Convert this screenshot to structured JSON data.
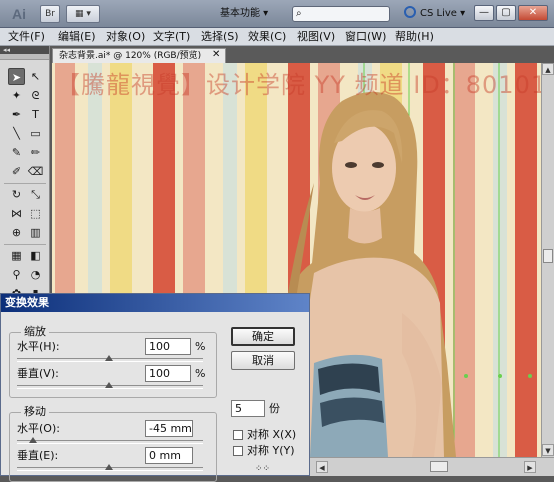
{
  "app": {
    "logo": "Ai",
    "workspace": "基本功能 ▾",
    "search_placeholder": "",
    "cs_live": "CS Live ▾",
    "window_buttons": {
      "minimize": "—",
      "restore": "▢",
      "close": "✕"
    }
  },
  "menu": [
    "文件(F)",
    "编辑(E)",
    "对象(O)",
    "文字(T)",
    "选择(S)",
    "效果(C)",
    "视图(V)",
    "窗口(W)",
    "帮助(H)"
  ],
  "document": {
    "tab": "杂志背景.ai* @ 120% (RGB/预览)",
    "tab_close": "✕",
    "watermark": "【騰龍視覺】设计学院 YY 频道 ID：80101"
  },
  "colors": {
    "stripe_red": "#d95c45",
    "stripe_salmon": "#e7a78f",
    "stripe_yellow": "#f0db85",
    "stripe_cream": "#f3e7c4",
    "stripe_mint": "#d8e2d6"
  },
  "dialog": {
    "title": "变换效果",
    "scale": {
      "group_label": "缩放",
      "horizontal_label": "水平(H):",
      "horizontal_value": "100",
      "horizontal_unit": "%",
      "vertical_label": "垂直(V):",
      "vertical_value": "100",
      "vertical_unit": "%"
    },
    "move": {
      "group_label": "移动",
      "horizontal_label": "水平(O):",
      "horizontal_value": "-45 mm",
      "vertical_label": "垂直(E):",
      "vertical_value": "0 mm"
    },
    "ok_label": "确定",
    "cancel_label": "取消",
    "copies_value": "5",
    "copies_label": "份",
    "reflect_x_label": "对称 X(X)",
    "reflect_y_label": "对称 Y(Y)"
  }
}
